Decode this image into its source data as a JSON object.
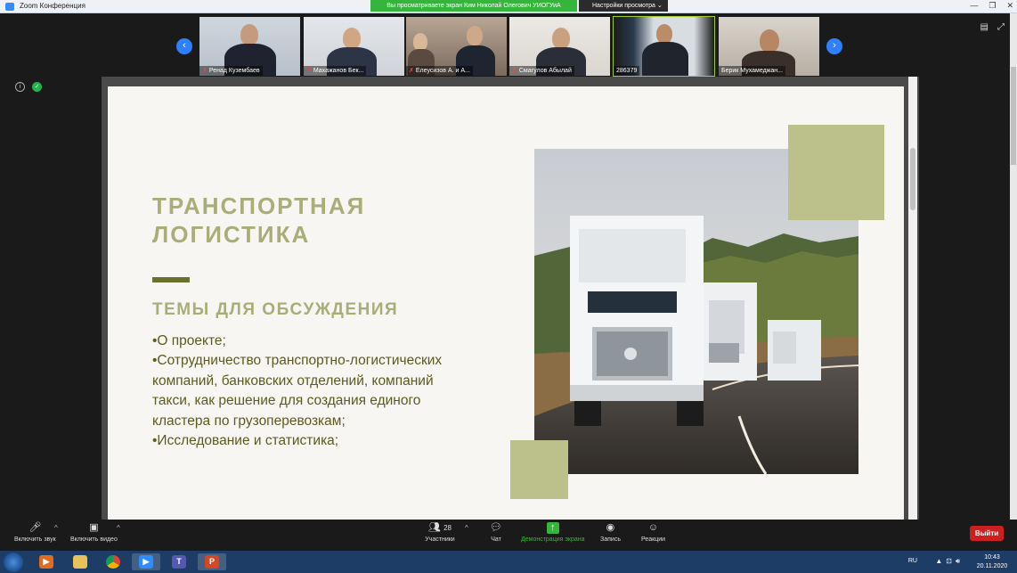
{
  "window": {
    "title": "Zoom Конференция",
    "share_banner": "Вы просматриваете экран Ким Николай Олегович УИОГУиА",
    "view_options": "Настройки просмотра"
  },
  "participants": [
    {
      "name": "Ренад Кузембаев",
      "muted": true
    },
    {
      "name": "Махажанов Бек...",
      "muted": true
    },
    {
      "name": "Елеусизов А. и А...",
      "muted": true
    },
    {
      "name": "Смагулов Абылай",
      "muted": true
    },
    {
      "name": "286379",
      "muted": false
    },
    {
      "name": "Берик Мухамеджан...",
      "muted": false
    }
  ],
  "slide": {
    "title_line1": "ТРАНСПОРТНАЯ",
    "title_line2": "ЛОГИСТИКА",
    "topics_heading": "ТЕМЫ ДЛЯ ОБСУЖДЕНИЯ",
    "lines": [
      "•О проекте;",
      "•Сотрудничество транспортно-логистических",
      "компаний, банковских отделений, компаний",
      "такси, как решение для создания единого",
      "кластера по грузоперевозкам;",
      "•Исследование и статистика;"
    ]
  },
  "toolbar": {
    "unmute": "Включить звук",
    "start_video": "Включить видео",
    "participants": "Участники",
    "participants_count": "28",
    "chat": "Чат",
    "share_screen": "Демонстрация экрана",
    "record": "Запись",
    "reactions": "Реакции",
    "leave": "Выйти"
  },
  "taskbar": {
    "language": "RU",
    "time": "10:43",
    "date": "20.11.2020"
  },
  "colors": {
    "accent_olive": "#a9ad78",
    "dark_olive": "#6a6f2e",
    "leave_red": "#cc1f1f",
    "share_green": "#36b53c"
  }
}
